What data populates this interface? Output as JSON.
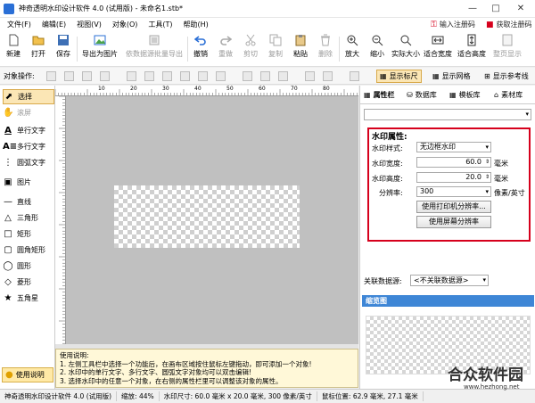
{
  "window": {
    "title": "神奇透明水印设计软件 4.0 (试用版) - 未命名1.stb*"
  },
  "menu": {
    "items": [
      "文件(F)",
      "编辑(E)",
      "视图(V)",
      "对象(O)",
      "工具(T)",
      "帮助(H)"
    ],
    "register": "输入注册码",
    "buy": "获取注册码"
  },
  "toolbar": {
    "new": "新建",
    "open": "打开",
    "save": "保存",
    "export": "导出为图片",
    "batch": "依数据源批量导出",
    "undo": "撤销",
    "redo": "重做",
    "cut": "剪切",
    "copy": "复制",
    "paste": "粘贴",
    "delete": "删除",
    "zoom_in": "放大",
    "zoom_out": "缩小",
    "actual": "实际大小",
    "fit_width": "适合宽度",
    "fit_height": "适合高度",
    "show_page": "整页显示"
  },
  "objbar": {
    "label": "对象操作:",
    "show_ruler": "显示标尺",
    "show_grid": "显示网格",
    "show_guides": "显示参考线"
  },
  "tools": {
    "select": "选择",
    "scroll": "滚屏",
    "single_text": "单行文字",
    "multi_text": "多行文字",
    "arc_text": "圆弧文字",
    "image": "图片",
    "line": "直线",
    "triangle": "三角形",
    "rect": "矩形",
    "round_rect": "圆角矩形",
    "ellipse": "圆形",
    "diamond": "菱形",
    "star": "五角星",
    "help": "使用说明"
  },
  "ruler": {
    "marks": [
      "10",
      "20",
      "30",
      "40",
      "50",
      "60",
      "70",
      "80",
      "90"
    ]
  },
  "info": {
    "title": "使用说明:",
    "line1": "1. 左侧工具栏中选择一个功能后，在画布区域按住鼠标左键拖动，即可添加一个对象!",
    "line2": "2. 水印中的单行文字、多行文字、圆弧文字对象均可以双击编辑!",
    "line3": "3. 选择水印中的任意一个对象，在右侧的属性栏里可以调整该对象的属性。"
  },
  "right_tabs": {
    "props": "属性栏",
    "data": "数据库",
    "template": "模板库",
    "material": "素材库"
  },
  "props": {
    "title": "水印属性:",
    "style_label": "水印样式:",
    "style_value": "无边框水印",
    "width_label": "水印宽度:",
    "width_value": "60.0",
    "width_unit": "毫米",
    "height_label": "水印高度:",
    "height_value": "20.0",
    "height_unit": "毫米",
    "dpi_label": "分辨率:",
    "dpi_value": "300",
    "dpi_unit": "像素/英寸",
    "printer_btn": "使用打印机分辨率...",
    "screen_btn": "使用屏幕分辨率"
  },
  "datasource": {
    "label": "关联数据源:",
    "value": "<不关联数据源>"
  },
  "preview": {
    "title": "缩览图"
  },
  "status": {
    "app": "神奇透明水印设计软件 4.0 (试用版)",
    "zoom": "缩放: 44%",
    "size": "水印尺寸: 60.0 毫米 x 20.0 毫米, 300 像素/英寸",
    "mouse": "鼠标位置: 62.9 毫米, 27.1 毫米"
  },
  "logo": {
    "cn": "合众软件园",
    "url": "www.hezhong.net"
  },
  "colors": {
    "highlight": "#d6001c",
    "accent": "#3e86d6"
  }
}
